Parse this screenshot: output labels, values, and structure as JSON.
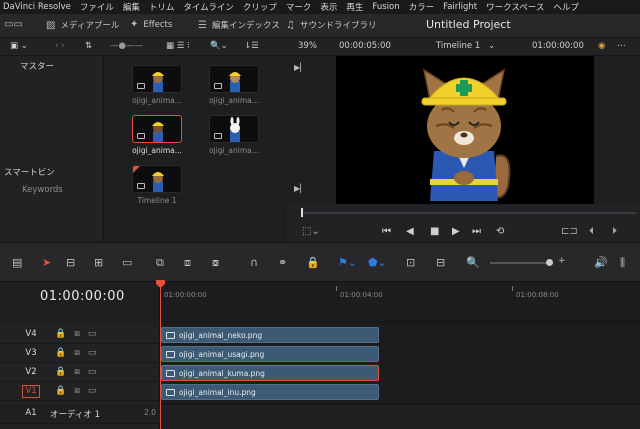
{
  "menubar": [
    "DaVinci Resolve",
    "ファイル",
    "編集",
    "トリム",
    "タイムライン",
    "クリップ",
    "マーク",
    "表示",
    "再生",
    "Fusion",
    "カラー",
    "Fairlight",
    "ワークスペース",
    "ヘルプ"
  ],
  "toolbar": {
    "media_pool_label": "メディアプール",
    "effects_label": "Effects",
    "edit_index_label": "編集インデックス",
    "sound_library_label": "サウンドライブラリ",
    "project_title": "Untitled Project"
  },
  "secbar": {
    "zoom": "39%",
    "timecode_duration": "00:00:05:00",
    "timeline_name": "Timeline 1",
    "timecode_current": "01:00:00:00"
  },
  "bins": {
    "master_label": "マスター",
    "smart_bins_label": "スマートビン",
    "keywords_label": "Keywords"
  },
  "media_clips": [
    {
      "label": "ojigi_anima...",
      "selected": false
    },
    {
      "label": "ojigi_anima...",
      "selected": false
    },
    {
      "label": "ojigi_anima...",
      "selected": true
    },
    {
      "label": "ojigi_anima...",
      "selected": false
    },
    {
      "label": "Timeline 1",
      "selected": false
    }
  ],
  "timeline": {
    "timecode": "01:00:00:00",
    "ruler_labels": [
      "01:00:00:00",
      "01:00:04:00",
      "01:00:08:00"
    ],
    "tracks": [
      {
        "name": "V4",
        "clip": "ojigi_animal_neko.png"
      },
      {
        "name": "V3",
        "clip": "ojigi_animal_usagi.png"
      },
      {
        "name": "V2",
        "clip": "ojigi_animal_kuma.png"
      },
      {
        "name": "V1",
        "clip": "ojigi_animal_inu.png"
      }
    ],
    "audio_track": {
      "name": "A1",
      "label": "オーディオ 1",
      "level": "2.0"
    }
  },
  "colors": {
    "accent": "#e0513e",
    "clip_blue": "#3d5a74"
  }
}
